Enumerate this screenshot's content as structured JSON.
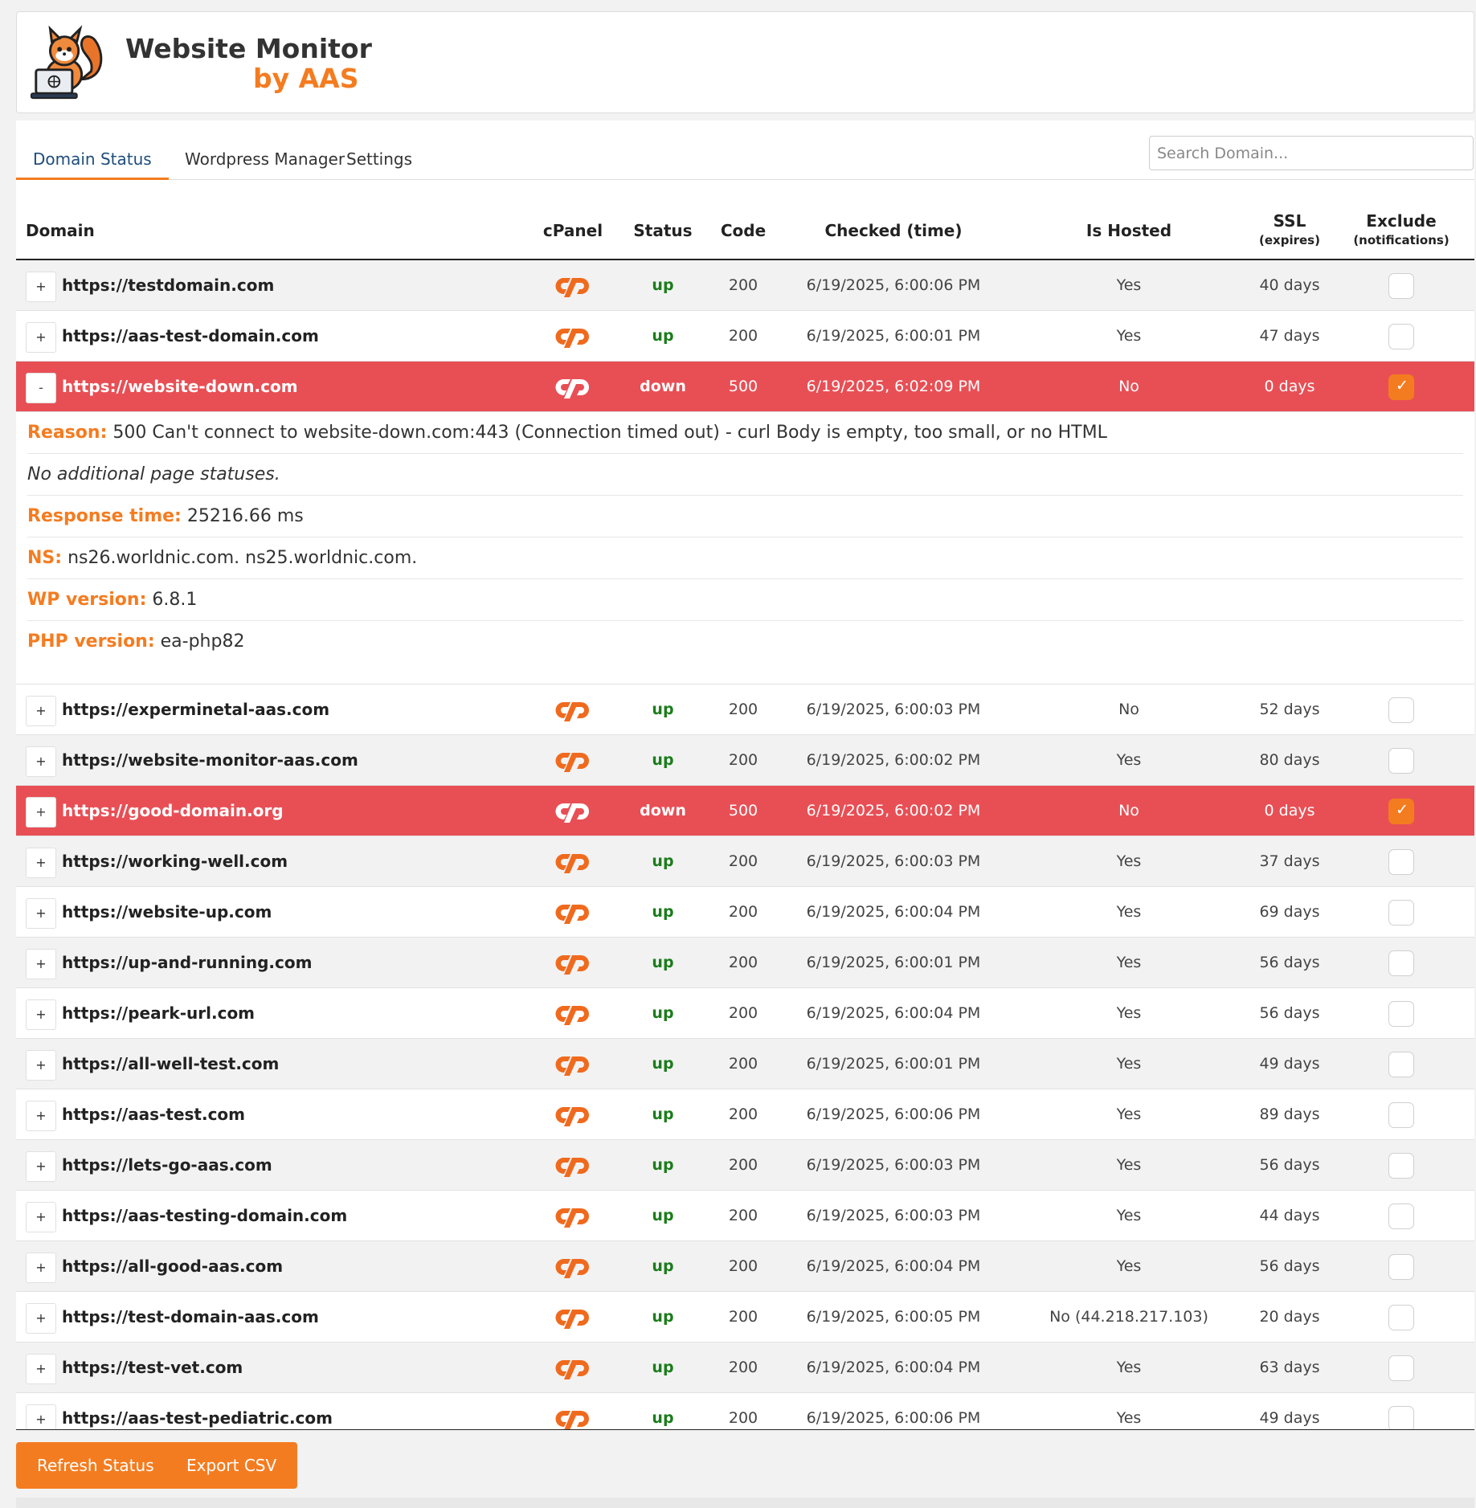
{
  "app": {
    "title": "Website Monitor",
    "subtitle": "by AAS",
    "logo_icon": "squirrel-laptop-logo"
  },
  "tabs": [
    {
      "label": "Domain Status",
      "active": true
    },
    {
      "label": "Wordpress Manager",
      "active": false
    },
    {
      "label": "Settings",
      "active": false
    }
  ],
  "search": {
    "placeholder": "Search Domain...",
    "value": ""
  },
  "columns": {
    "domain": "Domain",
    "cpanel": "cPanel",
    "status": "Status",
    "code": "Code",
    "checked": "Checked (time)",
    "hosted": "Is Hosted",
    "ssl": "SSL",
    "ssl_sub": "(expires)",
    "exclude": "Exclude",
    "exclude_sub": "(notifications)"
  },
  "rows": [
    {
      "toggle": "+",
      "domain": "https://testdomain.com",
      "status": "up",
      "code": "200",
      "checked": "6/19/2025, 6:00:06 PM",
      "hosted": "Yes",
      "ssl": "40 days",
      "excluded": false,
      "down": false
    },
    {
      "toggle": "+",
      "domain": "https://aas-test-domain.com",
      "status": "up",
      "code": "200",
      "checked": "6/19/2025, 6:00:01 PM",
      "hosted": "Yes",
      "ssl": "47 days",
      "excluded": false,
      "down": false
    },
    {
      "toggle": "-",
      "domain": "https://website-down.com",
      "status": "down",
      "code": "500",
      "checked": "6/19/2025, 6:02:09 PM",
      "hosted": "No",
      "ssl": "0 days",
      "excluded": true,
      "down": true,
      "expanded": true
    },
    {
      "toggle": "+",
      "domain": "https://experminetal-aas.com",
      "status": "up",
      "code": "200",
      "checked": "6/19/2025, 6:00:03 PM",
      "hosted": "No",
      "ssl": "52 days",
      "excluded": false,
      "down": false
    },
    {
      "toggle": "+",
      "domain": "https://website-monitor-aas.com",
      "status": "up",
      "code": "200",
      "checked": "6/19/2025, 6:00:02 PM",
      "hosted": "Yes",
      "ssl": "80 days",
      "excluded": false,
      "down": false
    },
    {
      "toggle": "+",
      "domain": "https://good-domain.org",
      "status": "down",
      "code": "500",
      "checked": "6/19/2025, 6:00:02 PM",
      "hosted": "No",
      "ssl": "0 days",
      "excluded": true,
      "down": true
    },
    {
      "toggle": "+",
      "domain": "https://working-well.com",
      "status": "up",
      "code": "200",
      "checked": "6/19/2025, 6:00:03 PM",
      "hosted": "Yes",
      "ssl": "37 days",
      "excluded": false,
      "down": false
    },
    {
      "toggle": "+",
      "domain": "https://website-up.com",
      "status": "up",
      "code": "200",
      "checked": "6/19/2025, 6:00:04 PM",
      "hosted": "Yes",
      "ssl": "69 days",
      "excluded": false,
      "down": false
    },
    {
      "toggle": "+",
      "domain": "https://up-and-running.com",
      "status": "up",
      "code": "200",
      "checked": "6/19/2025, 6:00:01 PM",
      "hosted": "Yes",
      "ssl": "56 days",
      "excluded": false,
      "down": false
    },
    {
      "toggle": "+",
      "domain": "https://peark-url.com",
      "status": "up",
      "code": "200",
      "checked": "6/19/2025, 6:00:04 PM",
      "hosted": "Yes",
      "ssl": "56 days",
      "excluded": false,
      "down": false
    },
    {
      "toggle": "+",
      "domain": "https://all-well-test.com",
      "status": "up",
      "code": "200",
      "checked": "6/19/2025, 6:00:01 PM",
      "hosted": "Yes",
      "ssl": "49 days",
      "excluded": false,
      "down": false
    },
    {
      "toggle": "+",
      "domain": "https://aas-test.com",
      "status": "up",
      "code": "200",
      "checked": "6/19/2025, 6:00:06 PM",
      "hosted": "Yes",
      "ssl": "89 days",
      "excluded": false,
      "down": false
    },
    {
      "toggle": "+",
      "domain": "https://lets-go-aas.com",
      "status": "up",
      "code": "200",
      "checked": "6/19/2025, 6:00:03 PM",
      "hosted": "Yes",
      "ssl": "56 days",
      "excluded": false,
      "down": false
    },
    {
      "toggle": "+",
      "domain": "https://aas-testing-domain.com",
      "status": "up",
      "code": "200",
      "checked": "6/19/2025, 6:00:03 PM",
      "hosted": "Yes",
      "ssl": "44 days",
      "excluded": false,
      "down": false
    },
    {
      "toggle": "+",
      "domain": "https://all-good-aas.com",
      "status": "up",
      "code": "200",
      "checked": "6/19/2025, 6:00:04 PM",
      "hosted": "Yes",
      "ssl": "56 days",
      "excluded": false,
      "down": false
    },
    {
      "toggle": "+",
      "domain": "https://test-domain-aas.com",
      "status": "up",
      "code": "200",
      "checked": "6/19/2025, 6:00:05 PM",
      "hosted": "No (44.218.217.103)",
      "ssl": "20 days",
      "excluded": false,
      "down": false
    },
    {
      "toggle": "+",
      "domain": "https://test-vet.com",
      "status": "up",
      "code": "200",
      "checked": "6/19/2025, 6:00:04 PM",
      "hosted": "Yes",
      "ssl": "63 days",
      "excluded": false,
      "down": false
    },
    {
      "toggle": "+",
      "domain": "https://aas-test-pediatric.com",
      "status": "up",
      "code": "200",
      "checked": "6/19/2025, 6:00:06 PM",
      "hosted": "Yes",
      "ssl": "49 days",
      "excluded": false,
      "down": false
    }
  ],
  "details": {
    "reason_label": "Reason:",
    "reason_value": "500 Can't connect to website-down.com:443 (Connection timed out) - curl Body is empty, too small, or no HTML",
    "page_statuses": "No additional page statuses.",
    "response_label": "Response time:",
    "response_value": "25216.66 ms",
    "ns_label": "NS:",
    "ns_value": "ns26.worldnic.com. ns25.worldnic.com.",
    "wp_label": "WP version:",
    "wp_value": "6.8.1",
    "php_label": "PHP version:",
    "php_value": "ea-php82"
  },
  "footer": {
    "refresh_label": "Refresh Status",
    "export_label": "Export CSV"
  },
  "colors": {
    "accent": "#f47c20",
    "down_row": "#e84f55",
    "up_text": "#1c7c1c"
  }
}
